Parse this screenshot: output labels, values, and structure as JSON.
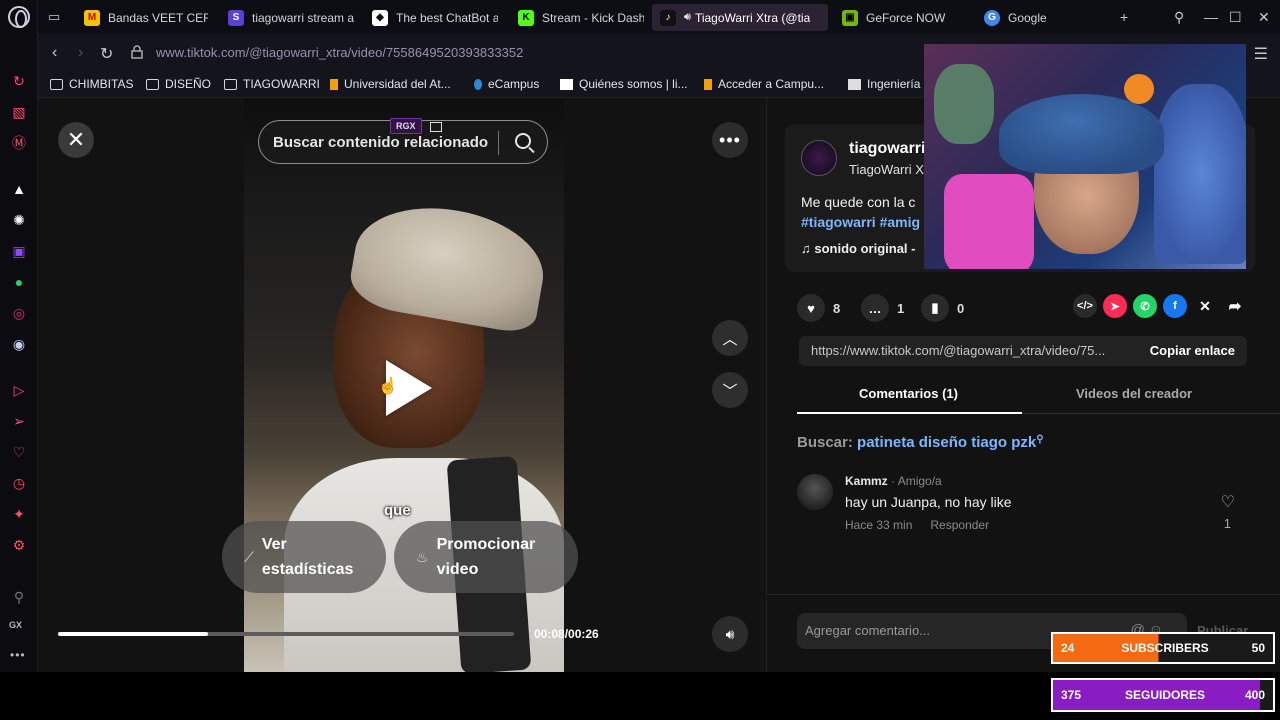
{
  "browser": {
    "tabs": [
      {
        "title": "Bandas VEET CERA",
        "fav_color": "#f5c400",
        "fav_glyph": "M"
      },
      {
        "title": "tiagowarri stream a",
        "fav_color": "#5b3fd6",
        "fav_glyph": "S"
      },
      {
        "title": "The best ChatBot a",
        "fav_color": "#ffffff",
        "fav_glyph": "◆"
      },
      {
        "title": "Stream - Kick Dash",
        "fav_color": "#53fc18",
        "fav_glyph": "K"
      },
      {
        "title": "TiagoWarri Xtra (@tia",
        "fav_color": "#111111",
        "fav_glyph": "♪"
      },
      {
        "title": "GeForce NOW",
        "fav_color": "#76b900",
        "fav_glyph": "▣"
      },
      {
        "title": "Google",
        "fav_color": "#4285f4",
        "fav_glyph": "G"
      }
    ],
    "url_base": "www.tiktok.com",
    "url_path": "/@tiagowarri_xtra/video/7558649520393833352",
    "bookmarks": [
      {
        "label": "CHIMBITAS",
        "type": "folder"
      },
      {
        "label": "DISEÑO",
        "type": "folder"
      },
      {
        "label": "TIAGOWARRI",
        "type": "folder"
      },
      {
        "label": "Universidad del At...",
        "type": "site"
      },
      {
        "label": "eCampus",
        "type": "site"
      },
      {
        "label": "Quiénes somos | li...",
        "type": "site"
      },
      {
        "label": "Acceder a Campu...",
        "type": "site"
      },
      {
        "label": "Ingeniería",
        "type": "site"
      }
    ]
  },
  "video": {
    "search_placeholder": "Buscar contenido relacionado",
    "rgx_badge": "RGX",
    "caption": "que",
    "stats_button": "Ver estadísticas",
    "promote_button": "Promocionar video",
    "time": "00:08/00:26",
    "progress_fraction": 0.33
  },
  "post": {
    "author_name": "tiagowarri",
    "author_sub": "TiagoWarri X",
    "description": "Me quede con la c",
    "hashtags": "#tiagowarri #amig",
    "music": "sonido original -",
    "likes": "8",
    "comments": "1",
    "saves": "0",
    "link": "https://www.tiktok.com/@tiagowarri_xtra/video/75...",
    "copy_label": "Copiar enlace",
    "tab_comments": "Comentarios (1)",
    "tab_videos": "Videos del creador",
    "search_label": "Buscar:",
    "search_value": "patineta diseño tiago pzk",
    "comment": {
      "user": "Kammz",
      "tag": "· Amigo/a",
      "text": "hay un Juanpa, no hay like",
      "time": "Hace 33 min",
      "reply": "Responder",
      "likes": "1"
    },
    "comment_placeholder": "Agregar comentario...",
    "publish": "Publicar"
  },
  "overlay": {
    "subs_current": "24",
    "subs_label": "SUBSCRIBERS",
    "subs_goal": "50",
    "subs_fraction": 0.48,
    "fol_current": "375",
    "fol_label": "SEGUIDORES",
    "fol_goal": "400",
    "fol_fraction": 0.94
  },
  "colors": {
    "accent_link": "#7bb7ff",
    "subs_bar": "#f36a12",
    "followers_bar": "#8a1cc4"
  }
}
